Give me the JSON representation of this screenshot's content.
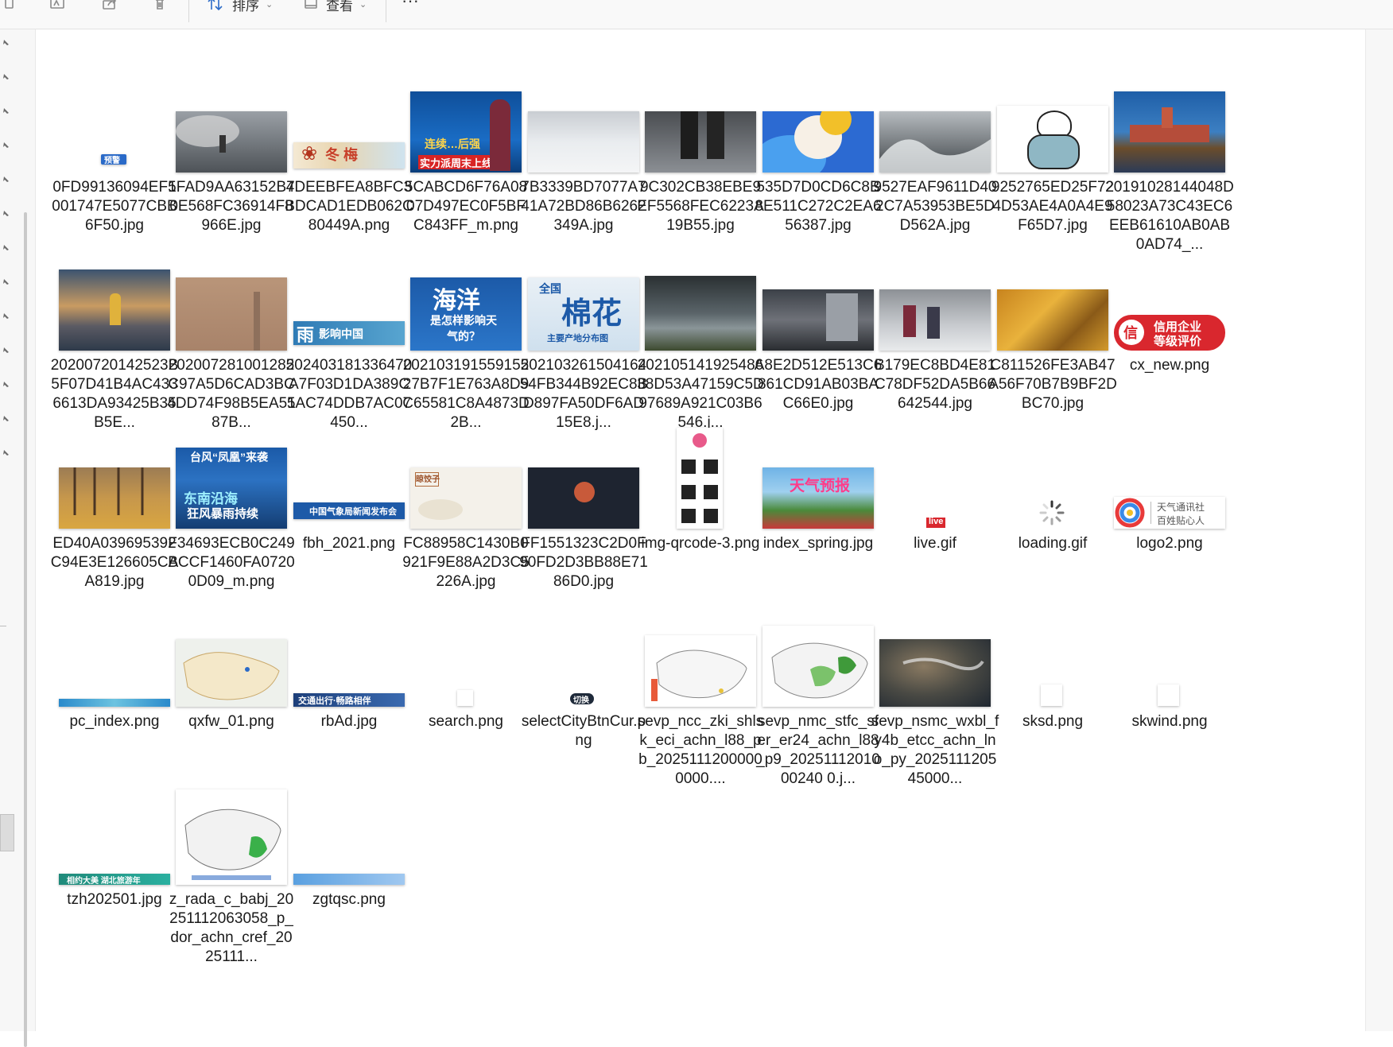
{
  "toolbar": {
    "sort_label": "排序",
    "view_label": "查看",
    "more_label": "···",
    "icons": [
      "copy-icon",
      "rename-icon",
      "share-icon",
      "delete-icon",
      "sort-icon",
      "view-icon",
      "more-icon"
    ]
  },
  "colors": {
    "accent_red": "#d9272e",
    "accent_blue": "#1d5aa8",
    "thumb_border": "#cfcfcf"
  },
  "thumb_text": {
    "warning_badge": "预警",
    "weekend_banner": "实力派周末上线",
    "weekend_top": "连续…后强",
    "ocean_title": "海洋",
    "ocean_sub": "是怎样影响天气的？",
    "cotton_top": "全国",
    "cotton_title": "棉花",
    "cotton_sub": "主要产地分布图",
    "rain_banner": "雨",
    "rain_banner_rest": "影响中国",
    "credit_line1": "信用企业",
    "credit_line2": "等级评价",
    "credit_seal": "信",
    "typhoon_top": "台风“凤凰”来袭",
    "typhoon_line1": "东南沿海",
    "typhoon_line2": "狂风暴雨持续",
    "fbh_banner": "中国气象局新闻发布会",
    "ink_stamp": "晾饺子",
    "weather_report": "天气预报",
    "live_badge": "live",
    "logo_line1": "天气通讯社",
    "logo_line2": "百姓贴心人",
    "switch_badge": "切换",
    "rbad_banner": "交通出行·畅路相伴",
    "tzh_banner": "相约大美 湖北旅游年"
  },
  "files": [
    {
      "name": "0FD99136094EF5001747E5077CBB6F50.jpg"
    },
    {
      "name": "1FAD9AA63152B70E568FC36914F8966E.jpg"
    },
    {
      "name": "4DEEBFEA8BFC3BDCAD1EDB062C80449A.png"
    },
    {
      "name": "5CABCD6F76A0807D497EC0F5BFC843FF_m.png"
    },
    {
      "name": "7B3339BD7077A741A72BD86B6262349A.jpg"
    },
    {
      "name": "9C302CB38EBE9EF5568FEC6223A19B55.jpg"
    },
    {
      "name": "535D7D0CD6C8B8E511C272C2EA656387.jpg"
    },
    {
      "name": "9527EAF9611D402C7A53953BE5DD562A.jpg"
    },
    {
      "name": "9252765ED25F724D53AE4A0A4E9F65D7.jpg"
    },
    {
      "name": "20191028144048D58023A73C43EC6EEB61610AB0AB0AD74_..."
    },
    {
      "name": "20200720142523B5F07D41B4AC4336613DA93425B35B5E..."
    },
    {
      "name": "202007281001285C97A5D6CAD3BC4DD74F98B5EA5187B..."
    },
    {
      "name": "202403181336470A7F03D1DA389C5AC74DDB7AC07450..."
    },
    {
      "name": "20210319155915527B7F1E763A8D9C65581C8A4873D2B..."
    },
    {
      "name": "20210326150416454FB344B92EC8BD897FA50DF6AD15E8.j..."
    },
    {
      "name": "20210514192548638D53A47159C5D97689A921C03B6546.j..."
    },
    {
      "name": "A8E2D512E513C6861CD91AB03BAC66E0.jpg"
    },
    {
      "name": "B179EC8BD4E81C78DF52DA5B66642544.jpg"
    },
    {
      "name": "C811526FE3AB47A56F70B7B9BF2DBC70.jpg"
    },
    {
      "name": "cx_new.png"
    },
    {
      "name": "ED40A039695392C94E3E126605CAA819.jpg"
    },
    {
      "name": "F34693ECB0C249BCCF1460FA07200D09_m.png"
    },
    {
      "name": "fbh_2021.png"
    },
    {
      "name": "FC88958C1430B0921F9E88A2D3C5226A.jpg"
    },
    {
      "name": "FF1551323C2D0F90FD2D3BB88E7186D0.jpg"
    },
    {
      "name": "img-qrcode-3.png"
    },
    {
      "name": "index_spring.jpg"
    },
    {
      "name": "live.gif"
    },
    {
      "name": "loading.gif"
    },
    {
      "name": "logo2.png"
    },
    {
      "name": "pc_index.png"
    },
    {
      "name": "qxfw_01.png"
    },
    {
      "name": "rbAd.jpg"
    },
    {
      "name": "search.png"
    },
    {
      "name": "selectCityBtnCur.png"
    },
    {
      "name": "sevp_ncc_zki_shlsk_eci_achn_l88_pb_20251112000000000...."
    },
    {
      "name": "sevp_nmc_stfc_sfer_er24_achn_l88_p9_2025111201000240 0.j..."
    },
    {
      "name": "sevp_nsmc_wxbl_fy4b_etcc_achn_lno_py_202511120545000..."
    },
    {
      "name": "sksd.png"
    },
    {
      "name": "skwind.png"
    },
    {
      "name": "tzh202501.jpg"
    },
    {
      "name": "z_rada_c_babj_20251112063058_p_dor_achn_cref_2025111..."
    },
    {
      "name": "zgtqsc.png"
    }
  ]
}
